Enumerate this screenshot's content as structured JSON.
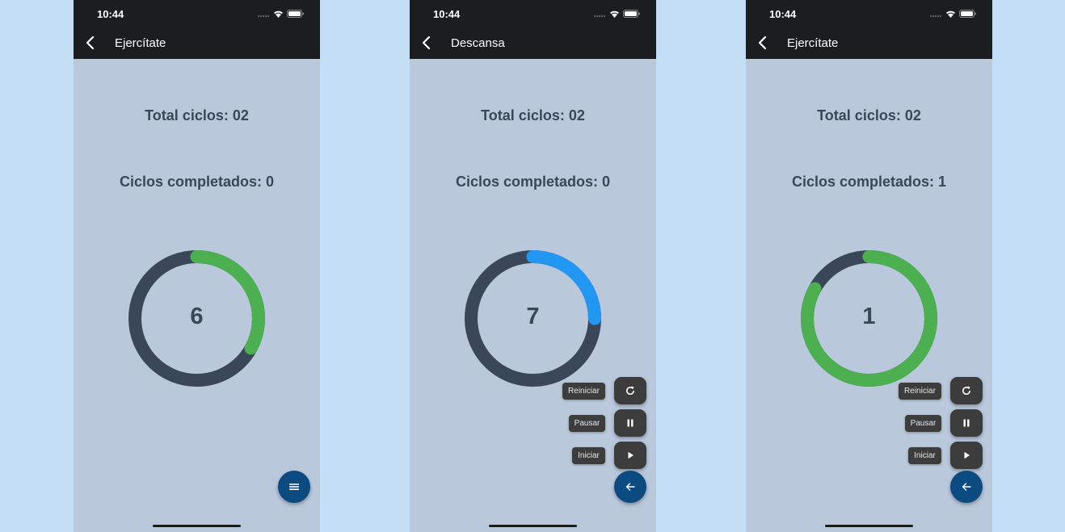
{
  "screens": [
    {
      "time": "10:44",
      "title": "Ejercítate",
      "total_cycles": "Total ciclos: 02",
      "completed_cycles": "Ciclos completados: 0",
      "count": "6",
      "progress_fraction": 0.33,
      "progress_color": "#4caf50",
      "fab_icon": "menu-icon",
      "actions_expanded": false
    },
    {
      "time": "10:44",
      "title": "Descansa",
      "total_cycles": "Total ciclos: 02",
      "completed_cycles": "Ciclos completados: 0",
      "count": "7",
      "progress_fraction": 0.25,
      "progress_color": "#2196f3",
      "fab_icon": "arrow-left-icon",
      "actions_expanded": true,
      "actions": {
        "restart": "Reiniciar",
        "pause": "Pausar",
        "start": "Iniciar"
      }
    },
    {
      "time": "10:44",
      "title": "Ejercítate",
      "total_cycles": "Total ciclos: 02",
      "completed_cycles": "Ciclos completados: 1",
      "count": "1",
      "progress_fraction": 0.83,
      "progress_color": "#4caf50",
      "fab_icon": "arrow-left-icon",
      "actions_expanded": true,
      "actions": {
        "restart": "Reiniciar",
        "pause": "Pausar",
        "start": "Iniciar"
      }
    }
  ],
  "colors": {
    "background": "#c3def5",
    "screen": "#bac8dc",
    "bar": "#1c1d1f",
    "track": "#3a4758",
    "fab": "#0b4b80",
    "mini_button": "#3c3c3c"
  }
}
